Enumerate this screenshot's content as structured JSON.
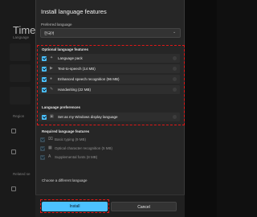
{
  "background": {
    "title": "Time",
    "side_labels": [
      "Language",
      "Region",
      "Related se"
    ]
  },
  "dialog": {
    "title": "Install language features",
    "preferred_language_label": "Preferred language",
    "preferred_language_value": "한국어",
    "optional_section_label": "Optional language features",
    "optional_features": [
      {
        "label": "Language pack",
        "checked": true,
        "icon": "language-pack-icon"
      },
      {
        "label": "Text-to-speech (14 MB)",
        "checked": true,
        "icon": "speech-icon"
      },
      {
        "label": "Enhanced speech recognition (96 MB)",
        "checked": true,
        "icon": "microphone-icon"
      },
      {
        "label": "Handwriting (22 MB)",
        "checked": true,
        "icon": "pen-icon"
      }
    ],
    "preferences_section_label": "Language preferences",
    "preferences": [
      {
        "label": "Set as my Windows display language",
        "checked": true,
        "icon": "display-icon"
      }
    ],
    "required_section_label": "Required language features",
    "required_features": [
      {
        "label": "Basic typing (9 MB)",
        "icon": "keyboard-icon"
      },
      {
        "label": "Optical character recognition (5 MB)",
        "icon": "ocr-icon"
      },
      {
        "label": "Supplemental fonts (8 MB)",
        "icon": "font-icon"
      }
    ],
    "choose_different": "Choose a different language",
    "install_label": "Install",
    "cancel_label": "Cancel"
  },
  "colors": {
    "accent": "#4cc2ff",
    "highlight": "#e01818"
  }
}
